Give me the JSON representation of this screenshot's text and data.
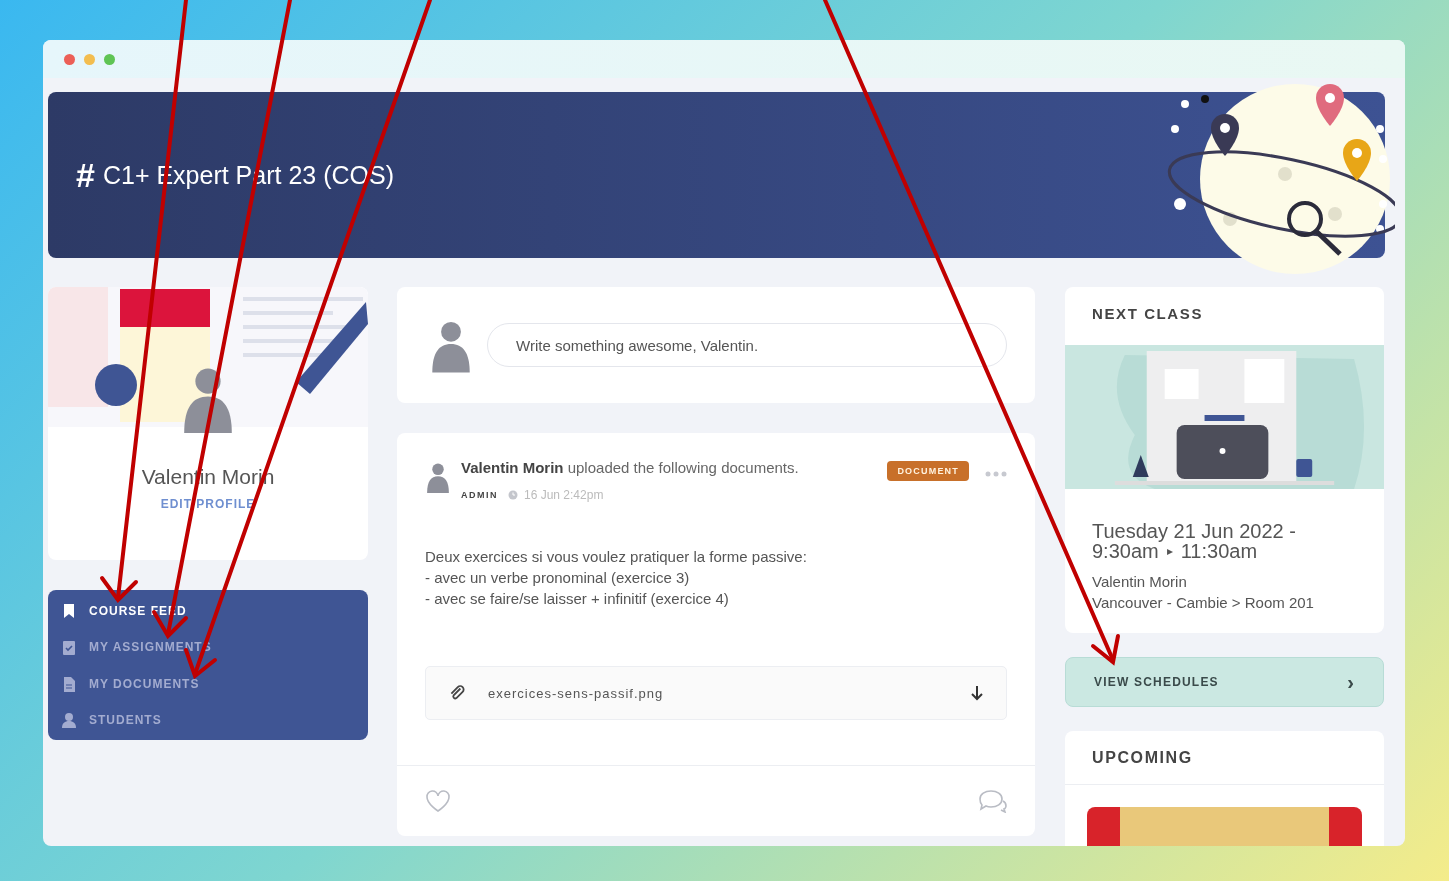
{
  "banner": {
    "icon": "#",
    "title": "C1+ Expert Part 23 (COS)"
  },
  "profile": {
    "name": "Valentin Morin",
    "link": "EDIT PROFILE"
  },
  "nav": [
    {
      "kind": "bookmark",
      "label": "COURSE FEED",
      "selected": true
    },
    {
      "kind": "clipboard",
      "label": "MY ASSIGNMENTS",
      "selected": false
    },
    {
      "kind": "document",
      "label": "MY DOCUMENTS",
      "selected": false
    },
    {
      "kind": "person",
      "label": "STUDENTS",
      "selected": false
    }
  ],
  "composer": {
    "placeholder": "Write something awesome, Valentin."
  },
  "post": {
    "author": "Valentin Morin",
    "action": "uploaded the following documents.",
    "tag": "DOCUMENT",
    "role": "ADMIN",
    "time": "16 Jun 2:42pm",
    "body": [
      "Deux exercices si vous voulez pratiquer la forme passive:",
      "- avec un verbe pronominal (exercice 3)",
      "- avec se faire/se laisser + infinitif (exercice 4)"
    ],
    "attachment": {
      "filename": "exercices-sens-passif.png"
    }
  },
  "next_class": {
    "heading": "NEXT CLASS",
    "date": "Tuesday 21 Jun 2022 -",
    "start": "9:30am",
    "separator": "▸",
    "end": "11:30am",
    "teacher": "Valentin Morin",
    "location": "Vancouver - Cambie > Room 201"
  },
  "schedules": {
    "label": "VIEW SCHEDULES",
    "chevron": "›"
  },
  "upcoming": {
    "heading": "UPCOMING"
  }
}
